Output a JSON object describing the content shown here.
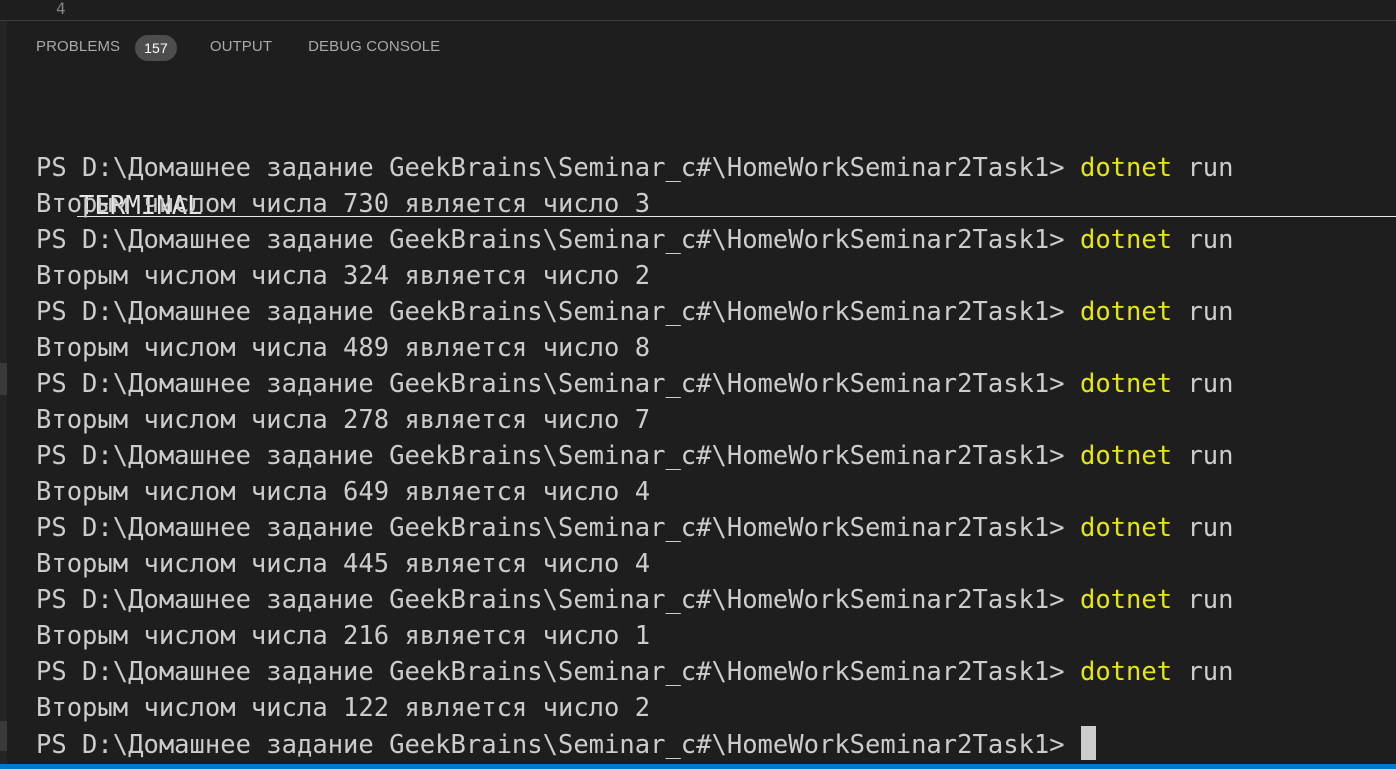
{
  "editor": {
    "line_number": "4"
  },
  "panel": {
    "tabs": {
      "problems": {
        "label": "PROBLEMS",
        "badge": "157"
      },
      "output": {
        "label": "OUTPUT"
      },
      "debug_console": {
        "label": "DEBUG CONSOLE"
      },
      "terminal": {
        "label": "TERMINAL",
        "active": true
      }
    }
  },
  "terminal": {
    "prompt": "PS D:\\Домашнее задание GeekBrains\\Seminar_c#\\HomeWorkSeminar2Task1> ",
    "lines": [
      {
        "kind": "command",
        "cmd": "dotnet",
        "arg": " run"
      },
      {
        "kind": "output",
        "text": "Вторым числом числа 730 является число 3"
      },
      {
        "kind": "command",
        "cmd": "dotnet",
        "arg": " run"
      },
      {
        "kind": "output",
        "text": "Вторым числом числа 324 является число 2"
      },
      {
        "kind": "command",
        "cmd": "dotnet",
        "arg": " run"
      },
      {
        "kind": "output",
        "text": "Вторым числом числа 489 является число 8"
      },
      {
        "kind": "command",
        "cmd": "dotnet",
        "arg": " run"
      },
      {
        "kind": "output",
        "text": "Вторым числом числа 278 является число 7"
      },
      {
        "kind": "command",
        "cmd": "dotnet",
        "arg": " run"
      },
      {
        "kind": "output",
        "text": "Вторым числом числа 649 является число 4"
      },
      {
        "kind": "command",
        "cmd": "dotnet",
        "arg": " run"
      },
      {
        "kind": "output",
        "text": "Вторым числом числа 445 является число 4"
      },
      {
        "kind": "command",
        "cmd": "dotnet",
        "arg": " run"
      },
      {
        "kind": "output",
        "text": "Вторым числом числа 216 является число 1"
      },
      {
        "kind": "command",
        "cmd": "dotnet",
        "arg": " run"
      },
      {
        "kind": "output",
        "text": "Вторым числом числа 122 является число 2"
      },
      {
        "kind": "prompt"
      }
    ]
  },
  "colors": {
    "background": "#1e1e1e",
    "text": "#cccccc",
    "command": "#e5e510",
    "accent": "#007acc"
  }
}
